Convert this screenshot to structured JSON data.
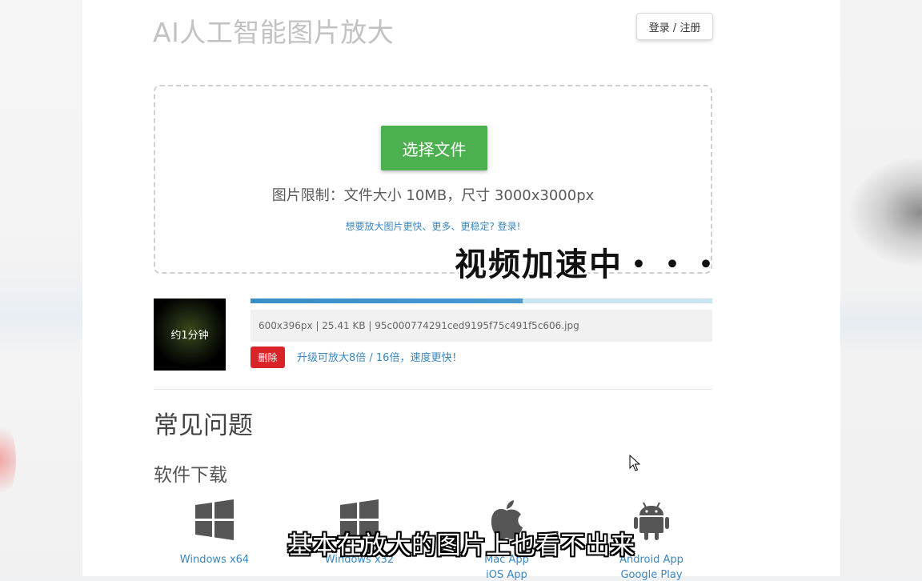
{
  "header": {
    "title": "AI人工智能图片放大",
    "login_label": "登录 / 注册"
  },
  "upload": {
    "choose_button": "选择文件",
    "limits_text": "图片限制：文件大小 10MB，尺寸 3000x3000px",
    "upsell_link": "想要放大图片更快、更多、更稳定? 登录!"
  },
  "job": {
    "thumbnail_label": "约1分钟",
    "progress_percent": 59,
    "file_info": "600x396px | 25.41 KB | 95c000774291ced9195f75c491f5c606.jpg",
    "delete_button": "删除",
    "upgrade_link": "升级可放大8倍 / 16倍，速度更快！"
  },
  "faq": {
    "title": "常见问题",
    "downloads_title": "软件下载",
    "downloads": [
      {
        "label": "Windows x64",
        "icon": "windows-icon"
      },
      {
        "label": "Windows x32",
        "icon": "windows-icon"
      },
      {
        "label": "Mac App",
        "label2": "iOS App",
        "icon": "apple-icon"
      },
      {
        "label": "Android App",
        "label2": "Google Play",
        "icon": "android-icon"
      }
    ]
  },
  "overlay": {
    "status_text": "视频加速中・・・",
    "subtitle": "基本在放大的图片上也看不出来"
  },
  "colors": {
    "primary_green": "#4caf50",
    "link_blue": "#3a87c0",
    "danger_red": "#d9242a",
    "progress_blue": "#3c8dc8"
  }
}
